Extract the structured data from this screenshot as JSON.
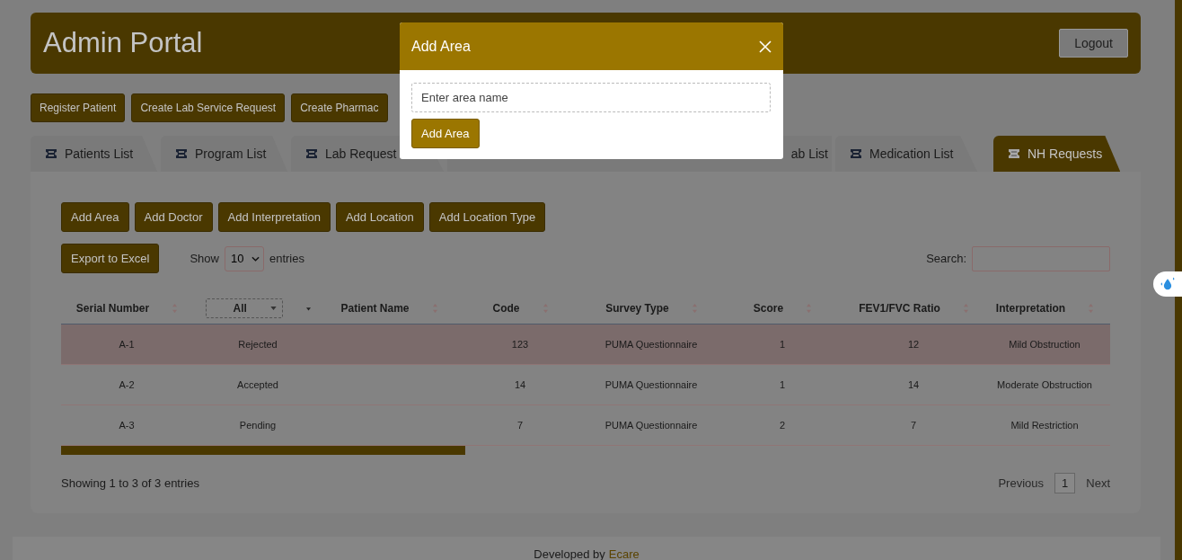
{
  "header": {
    "title": "Admin Portal",
    "logout": "Logout"
  },
  "actions": [
    "Register Patient",
    "Create Lab Service Request",
    "Create Pharmac"
  ],
  "tabs": [
    {
      "label": "Patients List",
      "selected": false
    },
    {
      "label": "Program List",
      "selected": false
    },
    {
      "label": "Lab Request",
      "selected": false
    },
    {
      "label": "ab List",
      "selected": false
    },
    {
      "label": "Medication List",
      "selected": false
    },
    {
      "label": "NH Requests",
      "selected": true
    }
  ],
  "panel_buttons": [
    "Add Area",
    "Add Doctor",
    "Add Interpretation",
    "Add Location",
    "Add Location Type"
  ],
  "export": "Export to Excel",
  "length": {
    "before": "Show",
    "value": "10",
    "after": "entries"
  },
  "search": {
    "label": "Search:"
  },
  "table": {
    "columns": [
      {
        "label": "Serial Number",
        "kind": "text"
      },
      {
        "label": "All",
        "kind": "filter"
      },
      {
        "label": "Patient Name",
        "kind": "text"
      },
      {
        "label": "Code",
        "kind": "text"
      },
      {
        "label": "Survey Type",
        "kind": "text"
      },
      {
        "label": "Score",
        "kind": "text"
      },
      {
        "label": "FEV1/FVC Ratio",
        "kind": "text"
      },
      {
        "label": "Interpretation",
        "kind": "text"
      }
    ],
    "rows": [
      {
        "highlighted": true,
        "cells": [
          "A-1",
          "Rejected",
          "",
          "123",
          "PUMA Questionnaire",
          "1",
          "12",
          "Mild Obstruction"
        ]
      },
      {
        "highlighted": false,
        "cells": [
          "A-2",
          "Accepted",
          "",
          "14",
          "PUMA Questionnaire",
          "1",
          "14",
          "Moderate Obstruction"
        ]
      },
      {
        "highlighted": false,
        "cells": [
          "A-3",
          "Pending",
          "",
          "7",
          "PUMA Questionnaire",
          "2",
          "7",
          "Mild Restriction"
        ]
      }
    ]
  },
  "info": "Showing 1 to 3 of 3 entries",
  "pagination": {
    "previous": "Previous",
    "pages": [
      {
        "label": "1",
        "selected": true
      }
    ],
    "next": "Next"
  },
  "footer": {
    "text": "Developed by",
    "link": "Ecare"
  },
  "modal": {
    "title": "Add Area",
    "placeholder": "Enter area name",
    "button": "Add Area"
  }
}
